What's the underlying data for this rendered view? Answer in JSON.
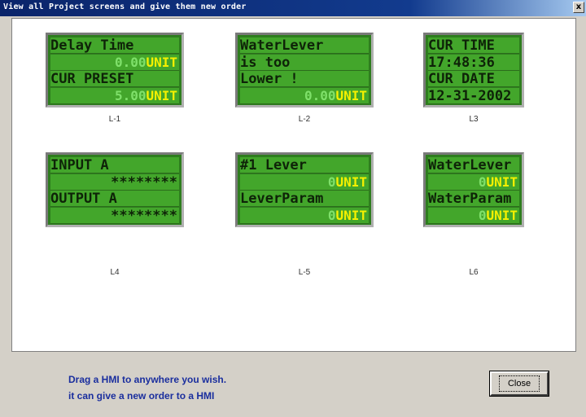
{
  "window": {
    "title": "View all Project screens and give them new order",
    "close_glyph": "x"
  },
  "screens": [
    {
      "label": "L-1",
      "rows": [
        {
          "text": "Delay Time",
          "style": "black"
        },
        {
          "prefix": "0.00",
          "text": "UNIT",
          "style": "value"
        },
        {
          "text": "CUR PRESET",
          "style": "black"
        },
        {
          "prefix": "5.00",
          "text": "UNIT",
          "style": "value"
        }
      ]
    },
    {
      "label": "L-2",
      "rows": [
        {
          "text": "WaterLever",
          "style": "black"
        },
        {
          "text": "is too",
          "style": "black"
        },
        {
          "text": "Lower !",
          "style": "black"
        },
        {
          "prefix": "0.00",
          "text": "UNIT",
          "style": "value"
        }
      ]
    },
    {
      "label": "L3",
      "rows": [
        {
          "text": "CUR TIME",
          "style": "black"
        },
        {
          "text": "17:48:36",
          "style": "black"
        },
        {
          "text": "CUR DATE",
          "style": "black"
        },
        {
          "text": "12-31-2002",
          "style": "black"
        }
      ]
    },
    {
      "label": "L4",
      "rows": [
        {
          "text": "INPUT A",
          "style": "black"
        },
        {
          "text": "********",
          "style": "stars"
        },
        {
          "text": "OUTPUT A",
          "style": "black"
        },
        {
          "text": "********",
          "style": "stars"
        }
      ]
    },
    {
      "label": "L-5",
      "rows": [
        {
          "text": "#1 Lever",
          "style": "black"
        },
        {
          "prefix": "0",
          "text": "UNIT",
          "style": "value"
        },
        {
          "text": "LeverParam",
          "style": "black"
        },
        {
          "prefix": "0",
          "text": "UNIT",
          "style": "value"
        }
      ]
    },
    {
      "label": "L6",
      "rows": [
        {
          "text": "WaterLever",
          "style": "black"
        },
        {
          "prefix": "0",
          "text": "UNIT",
          "style": "value"
        },
        {
          "text": "WaterParam",
          "style": "black"
        },
        {
          "prefix": "0",
          "text": "UNIT",
          "style": "value"
        }
      ]
    }
  ],
  "hint": {
    "line1": "Drag a HMI to anywhere  you wish.",
    "line2": "it can give a new order to a HMI"
  },
  "buttons": {
    "close": "Close"
  },
  "colors": {
    "screen_bg": "#2e7d1e",
    "row_bg": "#43a62b",
    "value_text": "#f4f000",
    "hint_text": "#1a2e9e"
  }
}
